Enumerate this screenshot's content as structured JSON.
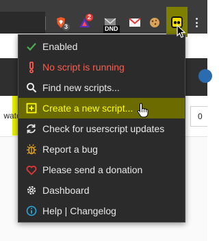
{
  "toolbar": {
    "extensions": [
      {
        "icon": "brave-shield-icon",
        "badge": "3"
      },
      {
        "icon": "brave-rewards-icon",
        "badge": "2"
      },
      {
        "icon": "dnd-mail-icon",
        "label": "DND"
      },
      {
        "icon": "mail-red-icon"
      },
      {
        "icon": "cookie-icon"
      },
      {
        "icon": "cat-icon"
      },
      {
        "icon": "tampermonkey-icon"
      }
    ]
  },
  "page": {
    "watch_text": "watc",
    "count": "0"
  },
  "menu": {
    "items": [
      {
        "icon": "check-icon",
        "label": "Enabled",
        "state": "normal",
        "color": "#4caf50"
      },
      {
        "icon": "info-exclamation-icon",
        "label": "No script is running",
        "state": "error",
        "color": "#ff5b4d"
      },
      {
        "icon": "search-icon",
        "label": "Find new scripts...",
        "state": "normal",
        "color": "#e8e8e8"
      },
      {
        "icon": "plus-square-icon",
        "label": "Create a new script...",
        "state": "highlighted",
        "color": "#ffff00"
      },
      {
        "icon": "refresh-icon",
        "label": "Check for userscript updates",
        "state": "normal",
        "color": "#e8e8e8"
      },
      {
        "icon": "bug-icon",
        "label": "Report a bug",
        "state": "normal",
        "color": "#e0a020"
      },
      {
        "icon": "heart-icon",
        "label": "Please send a donation",
        "state": "normal",
        "color": "#e53935"
      },
      {
        "icon": "gear-icon",
        "label": "Dashboard",
        "state": "normal",
        "color": "#e8e8e8"
      },
      {
        "icon": "info-icon",
        "label": "Help | Changelog",
        "state": "normal",
        "color": "#29a8e0"
      }
    ]
  },
  "colors": {
    "popup_bg": "#2b2b2b",
    "highlight_bg": "#6b6b00",
    "highlight_text": "#ffff00",
    "error_text": "#ff5b4d"
  }
}
